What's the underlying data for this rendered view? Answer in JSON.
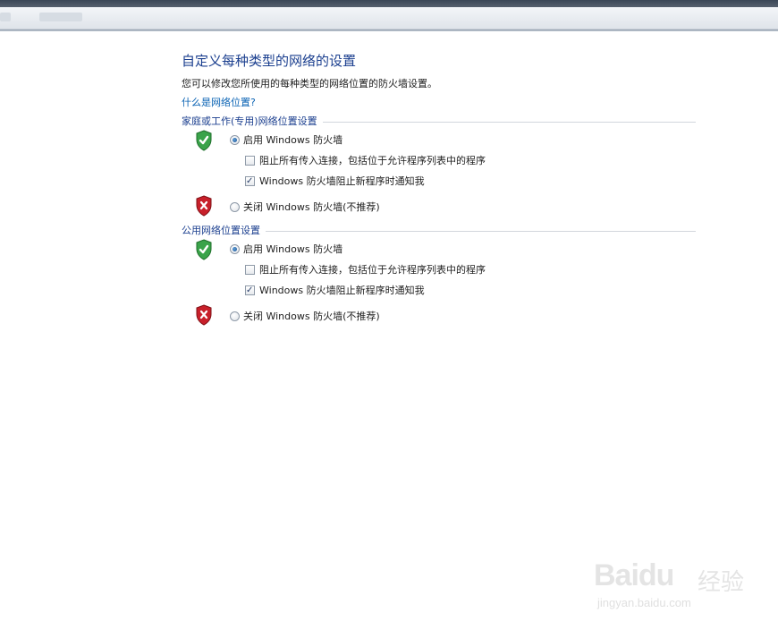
{
  "page": {
    "title": "自定义每种类型的网络的设置",
    "description": "您可以修改您所使用的每种类型的网络位置的防火墙设置。",
    "help_link": "什么是网络位置?"
  },
  "groups": [
    {
      "header": "家庭或工作(专用)网络位置设置",
      "enable_label": "启用 Windows 防火墙",
      "enable_checked": true,
      "block_all_label": "阻止所有传入连接，包括位于允许程序列表中的程序",
      "block_all_checked": false,
      "notify_label": "Windows 防火墙阻止新程序时通知我",
      "notify_checked": true,
      "disable_label": "关闭 Windows 防火墙(不推荐)",
      "disable_checked": false
    },
    {
      "header": "公用网络位置设置",
      "enable_label": "启用 Windows 防火墙",
      "enable_checked": true,
      "block_all_label": "阻止所有传入连接，包括位于允许程序列表中的程序",
      "block_all_checked": false,
      "notify_label": "Windows 防火墙阻止新程序时通知我",
      "notify_checked": true,
      "disable_label": "关闭 Windows 防火墙(不推荐)",
      "disable_checked": false
    }
  ],
  "icons": {
    "enabled_shield": "green-shield-check-icon",
    "disabled_shield": "red-shield-x-icon",
    "check_glyph": "✓"
  },
  "colors": {
    "title": "#1b3f8f",
    "link": "#0a63b4",
    "shield_green": "#3aa34a",
    "shield_red": "#c8202a"
  },
  "watermark": {
    "brand": "Baidu",
    "brand_cn": "经验",
    "url": "jingyan.baidu.com"
  }
}
